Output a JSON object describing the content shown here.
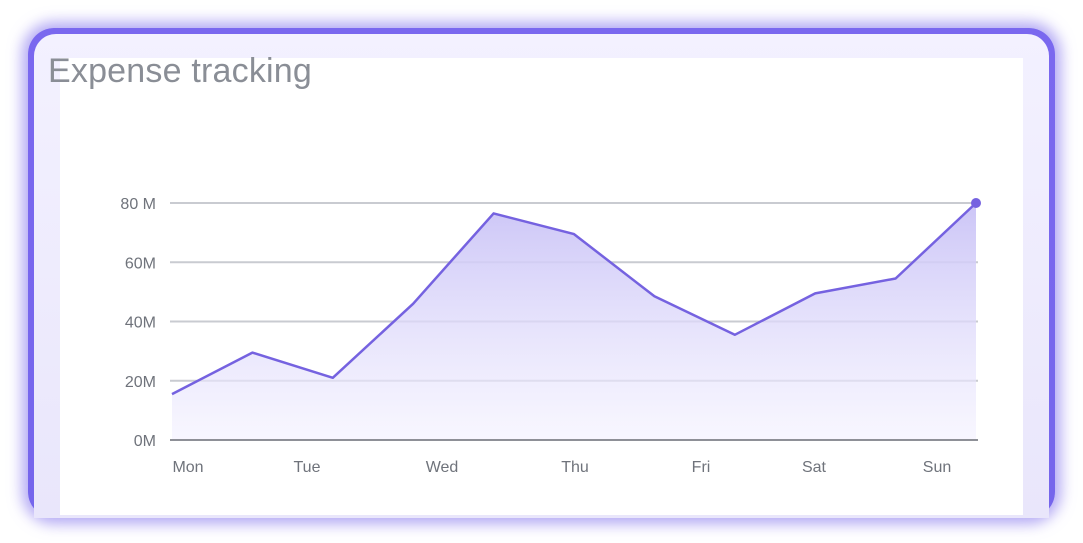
{
  "card": {
    "title": "Expense tracking"
  },
  "colors": {
    "frame": "#7565ec",
    "line": "#7562e0",
    "area_top": "#c9c2f6",
    "area_bottom": "#f3f1ff",
    "grid": "#c9cbd1",
    "axis": "#8e9097",
    "text": "#6f737b"
  },
  "chart_data": {
    "type": "area",
    "title": "Expense tracking",
    "xlabel": "",
    "ylabel": "",
    "ylim": [
      0,
      80
    ],
    "y_unit": "M",
    "y_ticks": [
      {
        "value": 0,
        "label": "0M"
      },
      {
        "value": 20,
        "label": "20M"
      },
      {
        "value": 40,
        "label": "40M"
      },
      {
        "value": 60,
        "label": "60M"
      },
      {
        "value": 80,
        "label": "80 M"
      }
    ],
    "x_labels": [
      "Mon",
      "Tue",
      "Wed",
      "Thu",
      "Fri",
      "Sat",
      "Sun"
    ],
    "grid": true,
    "series": [
      {
        "values": [
          15.5,
          29.5,
          21,
          46,
          76.5,
          69.5,
          48.5,
          35.5,
          49.5,
          54.5,
          80
        ]
      }
    ],
    "highlight_last_point": true
  }
}
